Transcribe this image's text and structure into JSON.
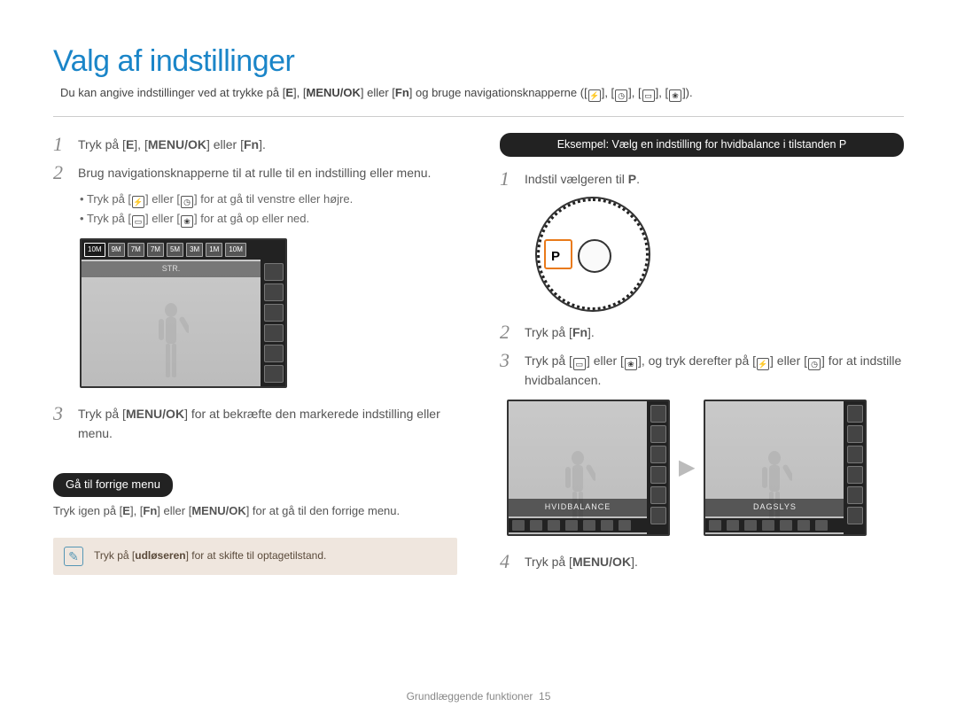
{
  "title": "Valg af indstillinger",
  "intro_prefix": "Du kan angive indstillinger ved at trykke på [",
  "intro_keys": {
    "e": "E",
    "sep1": "], [",
    "menu": "MENU/OK",
    "sep2": "] eller [",
    "fn": "Fn",
    "sep3": "] og bruge navigationsknapperne (["
  },
  "intro_suffix": "]).",
  "left": {
    "step1_a": "Tryk på [",
    "step1_e": "E",
    "step1_b": "], [",
    "step1_menu": "MENU/OK",
    "step1_c": "] eller [",
    "step1_fn": "Fn",
    "step1_d": "].",
    "step2": "Brug navigationsknapperne til at rulle til en indstilling eller menu.",
    "bullet1_a": "Tryk på [",
    "bullet1_b": "] eller [",
    "bullet1_c": "] for at gå til venstre eller højre.",
    "bullet2_a": "Tryk på [",
    "bullet2_b": "] eller [",
    "bullet2_c": "] for at gå op eller ned.",
    "lcd_label": "STR.",
    "lcd_chips": [
      "10M",
      "9M",
      "7M",
      "7M",
      "5M",
      "3M",
      "1M",
      "10M"
    ],
    "step3_a": "Tryk på [",
    "step3_menu": "MENU/OK",
    "step3_b": "] for at bekræfte den markerede indstilling eller menu.",
    "gohome_title": "Gå til forrige menu",
    "gohome_a": "Tryk igen på [",
    "gohome_e": "E",
    "gohome_b": "], [",
    "gohome_fn": "Fn",
    "gohome_c": "] eller [",
    "gohome_menu": "MENU/OK",
    "gohome_d": "] for at gå til den forrige menu.",
    "note_a": "Tryk på [",
    "note_shutter": "udløseren",
    "note_b": "] for at skifte til optagetilstand."
  },
  "right": {
    "example_header": "Eksempel: Vælg en indstilling for hvidbalance i tilstanden P",
    "step1_a": "Indstil vælgeren til ",
    "step1_p": "P",
    "step1_b": ".",
    "dial_P": "P",
    "step2_a": "Tryk på [",
    "step2_fn": "Fn",
    "step2_b": "].",
    "step3_a": "Tryk på [",
    "step3_b": "] eller [",
    "step3_c": "], og tryk derefter på [",
    "step3_d": "] eller [",
    "step3_e": "] for at indstille hvidbalancen.",
    "lcd1_label": "HVIDBALANCE",
    "lcd2_label": "DAGSLYS",
    "step4_a": "Tryk på [",
    "step4_menu": "MENU/OK",
    "step4_b": "]."
  },
  "footer_a": "Grundlæggende funktioner",
  "footer_b": "15"
}
